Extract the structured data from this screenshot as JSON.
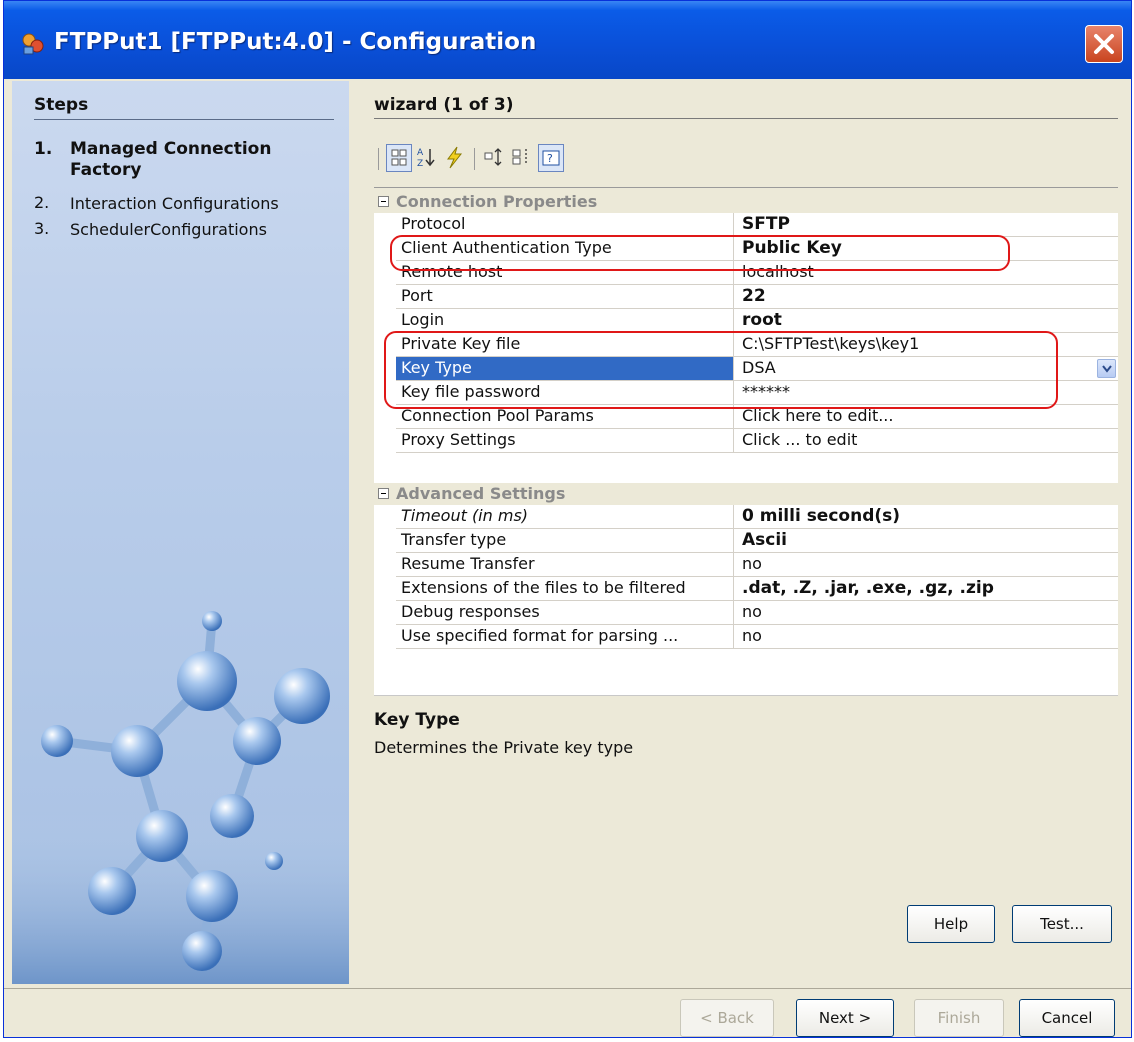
{
  "window": {
    "title": "FTPPut1 [FTPPut:4.0] - Configuration"
  },
  "steps": {
    "heading": "Steps",
    "items": [
      {
        "num": "1.",
        "label": "Managed Connection Factory",
        "current": true
      },
      {
        "num": "2.",
        "label": "Interaction Configurations",
        "current": false
      },
      {
        "num": "3.",
        "label": "SchedulerConfigurations",
        "current": false
      }
    ]
  },
  "main": {
    "heading": "wizard (1 of 3)"
  },
  "toolbar": {
    "icons": [
      "categorized-view-icon",
      "sort-alphabetic-icon",
      "lightning-icon",
      "expand-all-icon",
      "collapse-all-icon",
      "help-description-icon"
    ]
  },
  "properties": {
    "categories": [
      {
        "label": "Connection Properties",
        "rows": [
          {
            "name": "Protocol",
            "value": "SFTP",
            "bold": true
          },
          {
            "name": "Client Authentication Type",
            "value": "Public Key",
            "bold": true
          },
          {
            "name": "Remote host",
            "value": "localhost",
            "bold": false
          },
          {
            "name": "Port",
            "value": "22",
            "bold": true
          },
          {
            "name": "Login",
            "value": "root",
            "bold": true
          },
          {
            "name": "Private Key file",
            "value": "C:\\SFTPTest\\keys\\key1",
            "bold": false
          },
          {
            "name": "Key Type",
            "value": "DSA",
            "bold": false,
            "selected": true
          },
          {
            "name": "Key file password",
            "value": "******",
            "bold": false
          },
          {
            "name": "Connection Pool Params",
            "value": "Click here to edit...",
            "bold": false
          },
          {
            "name": "Proxy Settings",
            "value": "Click ... to edit",
            "bold": false
          }
        ]
      },
      {
        "label": "Advanced Settings",
        "rows": [
          {
            "name": "Timeout (in ms)",
            "value": "0 milli second(s)",
            "bold": true,
            "italic": true
          },
          {
            "name": "Transfer type",
            "value": "Ascii",
            "bold": true
          },
          {
            "name": "Resume Transfer",
            "value": "no",
            "bold": false
          },
          {
            "name": "Extensions of the files to be filtered",
            "value": ".dat, .Z, .jar, .exe, .gz, .zip",
            "bold": true
          },
          {
            "name": "Debug responses",
            "value": "no",
            "bold": false
          },
          {
            "name": "Use specified format for parsing ...",
            "value": "no",
            "bold": false
          }
        ]
      }
    ]
  },
  "description": {
    "title": "Key Type",
    "text": "Determines the Private key type"
  },
  "buttons": {
    "help": "Help",
    "test": "Test...",
    "back": "< Back",
    "next": "Next >",
    "finish": "Finish",
    "cancel": "Cancel"
  },
  "colors": {
    "titlebar": "#0a50d9",
    "selection": "#316ac5",
    "highlight_box": "#e01818",
    "dialog_bg": "#ece9d8"
  }
}
